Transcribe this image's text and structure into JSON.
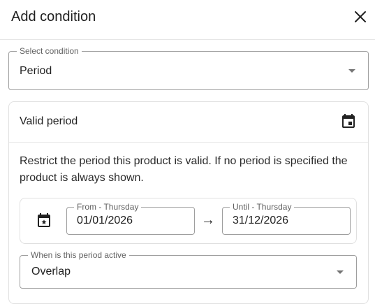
{
  "dialog": {
    "title": "Add condition"
  },
  "condition_select": {
    "label": "Select condition",
    "value": "Period"
  },
  "card": {
    "title": "Valid period",
    "description": "Restrict the period this product is valid. If no period is specified the product is always shown."
  },
  "from_date": {
    "label": "From - Thursday",
    "value": "01/01/2026"
  },
  "until_date": {
    "label": "Until - Thursday",
    "value": "31/12/2026"
  },
  "arrow": "→",
  "active_select": {
    "label": "When is this period active",
    "value": "Overlap"
  },
  "icons": {
    "close": "close-icon",
    "card_calendar": "event-icon",
    "date_calendar": "event-icon",
    "select_caret": "arrow-drop-down-icon"
  }
}
